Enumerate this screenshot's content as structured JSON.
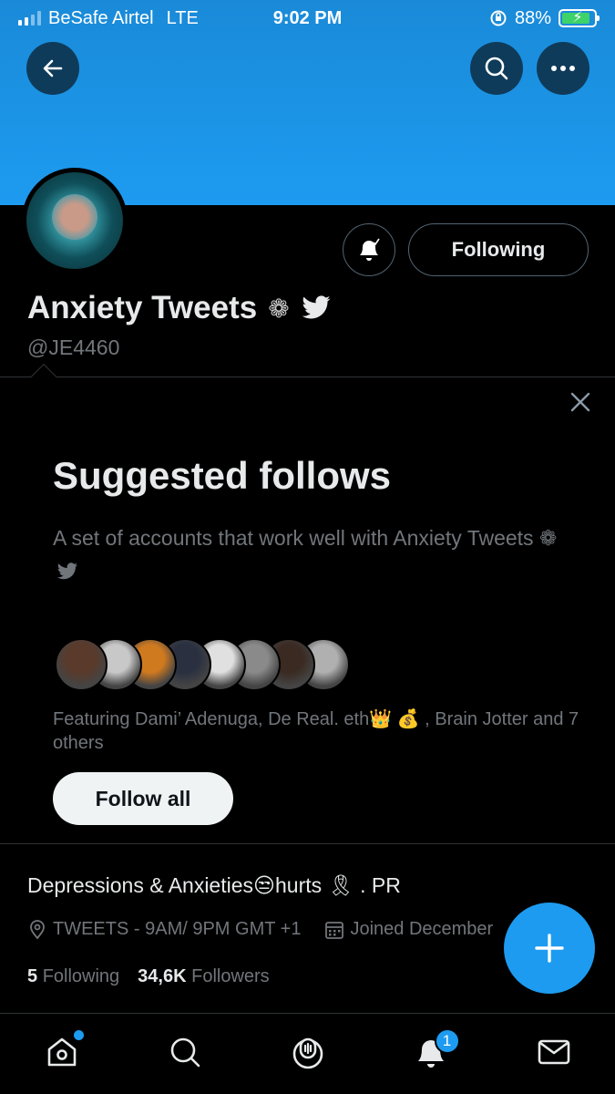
{
  "status_bar": {
    "carrier": "BeSafe Airtel",
    "network": "LTE",
    "time": "9:02 PM",
    "battery": "88%",
    "battery_level": 0.88
  },
  "header": {
    "back_icon": "arrow-left-icon",
    "search_icon": "search-icon",
    "more_icon": "more-horizontal-icon",
    "banner_color": "#1d9bf0"
  },
  "profile": {
    "display_name": "Anxiety Tweets",
    "name_badges": "❁",
    "handle": "@JE4460",
    "following_button": "Following",
    "bell_icon": "bell-subscribed-icon",
    "bio": "Depressions & Anxieties😒hurts 🎗 . PR",
    "location": "TWEETS - 9AM/ 9PM GMT +1",
    "joined": "Joined December",
    "following_count": "5",
    "following_label": "Following",
    "followers_count": "34,6K",
    "followers_label": "Followers"
  },
  "suggested": {
    "title": "Suggested follows",
    "description": "A set of accounts that work well with Anxiety Tweets ❁",
    "featuring": "Featuring Dami’ Adenuga, De Real. eth👑 💰 , Brain Jotter and 7 others",
    "follow_all_button": "Follow all",
    "avatar_colors": [
      "#5a3a2a",
      "#c8c8c8",
      "#d07a20",
      "#2a3040",
      "#e0e0e0",
      "#8a8a8a",
      "#3a2a22",
      "#b0b0b0"
    ]
  },
  "tabbar": {
    "items": [
      {
        "name": "home-icon",
        "has_dot": true
      },
      {
        "name": "search-icon"
      },
      {
        "name": "spaces-icon"
      },
      {
        "name": "notifications-icon",
        "badge": "1"
      },
      {
        "name": "messages-icon"
      }
    ]
  },
  "colors": {
    "accent": "#1d9bf0",
    "background": "#000000",
    "secondary_text": "#71767b"
  }
}
